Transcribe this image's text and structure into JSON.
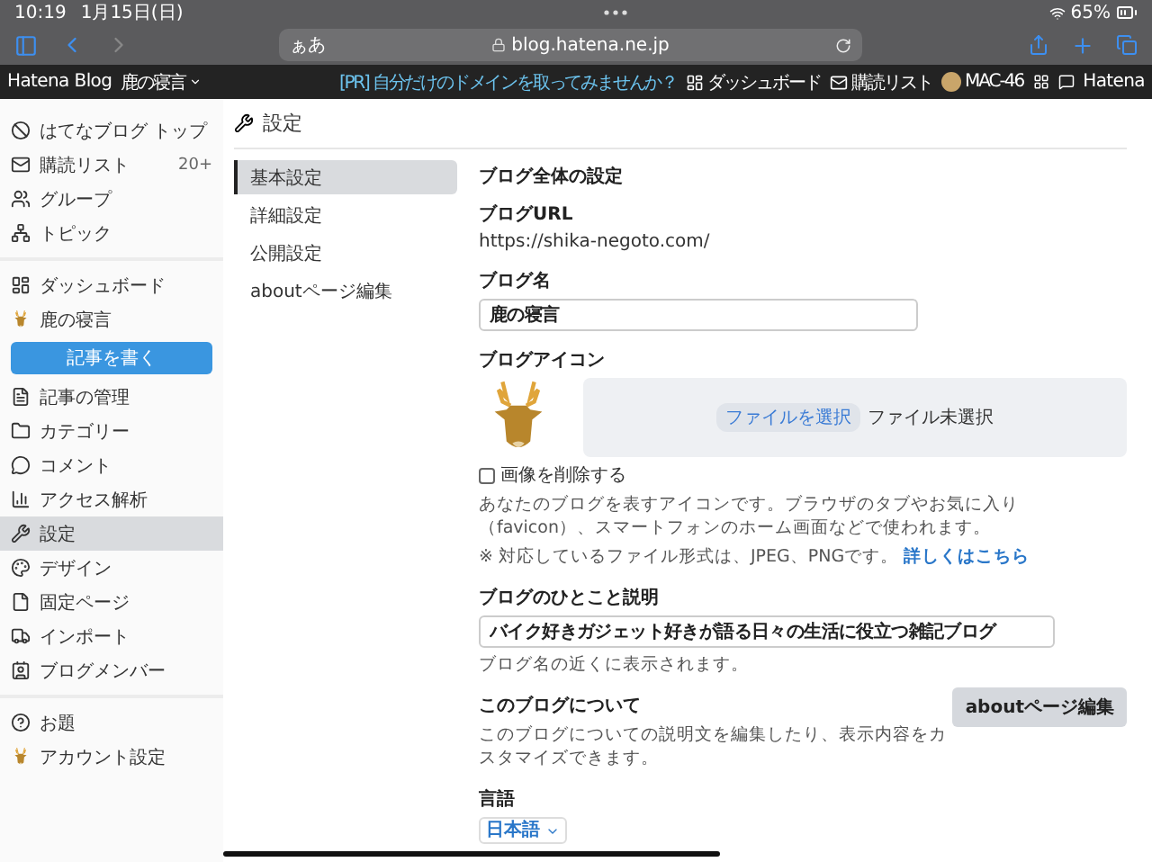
{
  "status_bar": {
    "time": "10:19",
    "date": "1月15日(日)",
    "battery": "65%"
  },
  "browser": {
    "text_size_button": "ぁあ",
    "url": "blog.hatena.ne.jp"
  },
  "hatena_bar": {
    "logo": "Hatena Blog",
    "blog_menu": "鹿の寝言",
    "promo": "[PR] 自分だけのドメインを取ってみませんか？",
    "links": [
      {
        "label": "ダッシュボード",
        "kind": "dashboard"
      },
      {
        "label": "購読リスト",
        "kind": "subscriptions"
      },
      {
        "label": "MAC-46",
        "kind": "user"
      }
    ],
    "brand": "Hatena"
  },
  "sidebar": {
    "groups": [
      [
        {
          "label": "はてなブログ トップ",
          "selected": false
        },
        {
          "label": "購読リスト",
          "badge": "20+",
          "selected": false
        },
        {
          "label": "グループ",
          "selected": false
        },
        {
          "label": "トピック",
          "selected": false
        }
      ],
      [
        {
          "label": "ダッシュボード",
          "selected": false
        },
        {
          "label": "鹿の寝言",
          "selected": false
        },
        {
          "label": "記事を書く",
          "kind": "button",
          "selected": false
        },
        {
          "label": "記事の管理",
          "selected": false
        },
        {
          "label": "カテゴリー",
          "selected": false
        },
        {
          "label": "コメント",
          "selected": false
        },
        {
          "label": "アクセス解析",
          "selected": false
        },
        {
          "label": "設定",
          "selected": true
        },
        {
          "label": "デザイン",
          "selected": false
        },
        {
          "label": "固定ページ",
          "selected": false
        },
        {
          "label": "インポート",
          "selected": false
        },
        {
          "label": "ブログメンバー",
          "selected": false
        }
      ],
      [
        {
          "label": "お題",
          "selected": false
        },
        {
          "label": "アカウント設定",
          "selected": false
        }
      ]
    ]
  },
  "settings": {
    "title": "設定",
    "nav": [
      {
        "label": "基本設定",
        "selected": true
      },
      {
        "label": "詳細設定",
        "selected": false
      },
      {
        "label": "公開設定",
        "selected": false
      },
      {
        "label": "aboutページ編集",
        "selected": false
      }
    ],
    "section_title": "ブログ全体の設定",
    "blog_url": {
      "label": "ブログURL",
      "value": "https://shika-negoto.com/"
    },
    "blog_name": {
      "label": "ブログ名",
      "value": "鹿の寝言"
    },
    "blog_icon": {
      "label": "ブログアイコン",
      "file_button": "ファイルを選択",
      "file_status": "ファイル未選択",
      "delete_checkbox": {
        "label": "画像を削除する",
        "checked": false
      },
      "description": "あなたのブログを表すアイコンです。ブラウザのタブやお気に入り（favicon）、スマートフォンのホーム画面などで使われます。",
      "note": "※ 対応しているファイル形式は、JPEG、PNGです。",
      "note_link": "詳しくはこちら"
    },
    "tagline": {
      "label": "ブログのひとこと説明",
      "value": "バイク好きガジェット好きが語る日々の生活に役立つ雑記ブログ",
      "hint": "ブログ名の近くに表示されます。"
    },
    "about": {
      "label": "このブログについて",
      "text": "このブログについての説明文を編集したり、表示内容をカスタマイズできます。",
      "button": "aboutページ編集"
    },
    "language": {
      "label": "言語",
      "value": "日本語"
    }
  }
}
